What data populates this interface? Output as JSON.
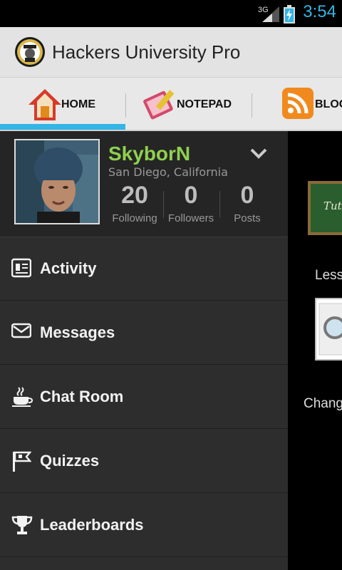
{
  "status_bar": {
    "network": "3G",
    "time": "3:54",
    "accent": "#33b5e5"
  },
  "app": {
    "title": "Hackers University Pro"
  },
  "tabs": [
    {
      "label": "HOME",
      "icon": "home-icon",
      "active": true
    },
    {
      "label": "NOTEPAD",
      "icon": "notepad-icon",
      "active": false
    },
    {
      "label": "BLOG",
      "icon": "rss-icon",
      "active": false
    }
  ],
  "profile": {
    "username": "SkyborN",
    "location": "San Diego, California",
    "stats": [
      {
        "value": "20",
        "label": "Following"
      },
      {
        "value": "0",
        "label": "Followers"
      },
      {
        "value": "0",
        "label": "Posts"
      }
    ],
    "username_color": "#8fd14f"
  },
  "menu": [
    {
      "label": "Activity",
      "icon": "newspaper-icon"
    },
    {
      "label": "Messages",
      "icon": "envelope-icon"
    },
    {
      "label": "Chat Room",
      "icon": "coffee-cup-icon"
    },
    {
      "label": "Quizzes",
      "icon": "flag-icon"
    },
    {
      "label": "Leaderboards",
      "icon": "trophy-icon"
    }
  ],
  "content": {
    "chalkboard_text": "Tuto",
    "lessons_label": "Less",
    "change_label": "Chang"
  }
}
